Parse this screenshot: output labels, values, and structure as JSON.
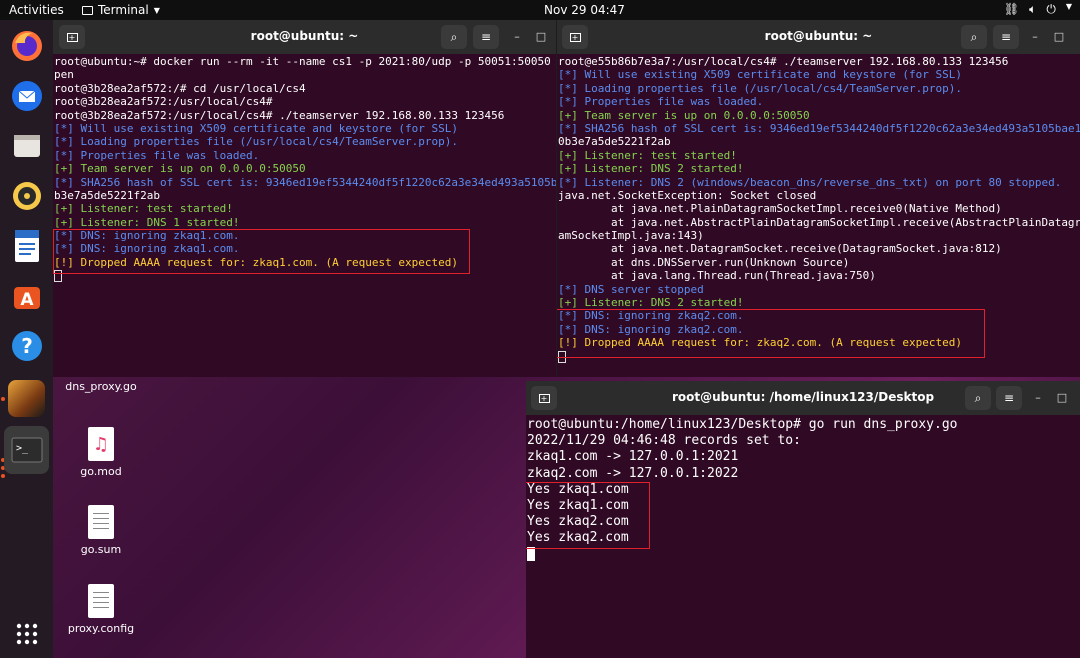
{
  "topbar": {
    "activities": "Activities",
    "app": "Terminal",
    "clock": "Nov 29  04:47"
  },
  "dock": {
    "items": [
      "firefox-icon",
      "thunderbird-icon",
      "files-icon",
      "rhythmbox-icon",
      "writer-icon",
      "software-icon",
      "help-icon",
      "avatar-icon",
      "terminal-icon"
    ],
    "apps_grid": "show-apps-icon"
  },
  "desktop": {
    "icons": [
      {
        "label": "dns_proxy.go"
      },
      {
        "label": "go.mod"
      },
      {
        "label": "go.sum"
      },
      {
        "label": "proxy.config"
      }
    ]
  },
  "term1": {
    "title": "root@ubuntu: ~",
    "lines": [
      {
        "t": "root@ubuntu:~# docker run --rm -it --name cs1 -p 2021:80/udp -p 50051:50050",
        "c": ""
      },
      {
        "t": "pen",
        "c": ""
      },
      {
        "t": "root@3b28ea2af572:/# cd /usr/local/cs4",
        "c": ""
      },
      {
        "t": "root@3b28ea2af572:/usr/local/cs4#",
        "c": ""
      },
      {
        "t": "root@3b28ea2af572:/usr/local/cs4# ./teamserver 192.168.80.133 123456",
        "c": ""
      },
      {
        "p": "[*]",
        "t": " Will use existing X509 certificate and keystore (for SSL)",
        "c": "blue"
      },
      {
        "p": "[*]",
        "t": " Loading properties file (/usr/local/cs4/TeamServer.prop).",
        "c": "blue"
      },
      {
        "p": "[*]",
        "t": " Properties file was loaded.",
        "c": "blue"
      },
      {
        "p": "[+]",
        "t": " Team server is up on 0.0.0.0:50050",
        "c": "green"
      },
      {
        "p": "[*]",
        "t": " SHA256 hash of SSL cert is: 9346ed19ef5344240df5f1220c62a3e34ed493a5105b",
        "c": "blue"
      },
      {
        "t": "b3e7a5de5221f2ab",
        "c": ""
      },
      {
        "p": "[+]",
        "t": " Listener: test started!",
        "c": "green"
      },
      {
        "p": "[+]",
        "t": " Listener: DNS 1 started!",
        "c": "green"
      },
      {
        "p": "[*]",
        "t": " DNS: ignoring zkaq1.com.",
        "c": "blue"
      },
      {
        "p": "[*]",
        "t": " DNS: ignoring zkaq1.com.",
        "c": "blue"
      },
      {
        "p": "[!]",
        "t": " Dropped AAAA request for: zkaq1.com. (A request expected)",
        "c": "yellow"
      }
    ]
  },
  "term2": {
    "title": "root@ubuntu: ~",
    "lines": [
      {
        "t": "root@e55b86b7e3a7:/usr/local/cs4# ./teamserver 192.168.80.133 123456",
        "c": ""
      },
      {
        "p": "[*]",
        "t": " Will use existing X509 certificate and keystore (for SSL)",
        "c": "blue"
      },
      {
        "p": "[*]",
        "t": " Loading properties file (/usr/local/cs4/TeamServer.prop).",
        "c": "blue"
      },
      {
        "p": "[*]",
        "t": " Properties file was loaded.",
        "c": "blue"
      },
      {
        "p": "[+]",
        "t": " Team server is up on 0.0.0.0:50050",
        "c": "green"
      },
      {
        "p": "[*]",
        "t": " SHA256 hash of SSL cert is: 9346ed19ef5344240df5f1220c62a3e34ed493a5105bae1",
        "c": "blue"
      },
      {
        "t": "0b3e7a5de5221f2ab",
        "c": ""
      },
      {
        "p": "[+]",
        "t": " Listener: test started!",
        "c": "green"
      },
      {
        "p": "[+]",
        "t": " Listener: DNS 2 started!",
        "c": "green"
      },
      {
        "p": "[*]",
        "t": " Listener: DNS 2 (windows/beacon_dns/reverse_dns_txt) on port 80 stopped.",
        "c": "blue"
      },
      {
        "t": "java.net.SocketException: Socket closed",
        "c": ""
      },
      {
        "t": "        at java.net.PlainDatagramSocketImpl.receive0(Native Method)",
        "c": ""
      },
      {
        "t": "        at java.net.AbstractPlainDatagramSocketImpl.receive(AbstractPlainDatagr",
        "c": ""
      },
      {
        "t": "amSocketImpl.java:143)",
        "c": ""
      },
      {
        "t": "        at java.net.DatagramSocket.receive(DatagramSocket.java:812)",
        "c": ""
      },
      {
        "t": "        at dns.DNSServer.run(Unknown Source)",
        "c": ""
      },
      {
        "t": "        at java.lang.Thread.run(Thread.java:750)",
        "c": ""
      },
      {
        "p": "[*]",
        "t": " DNS server stopped",
        "c": "blue"
      },
      {
        "p": "[+]",
        "t": " Listener: DNS 2 started!",
        "c": "green"
      },
      {
        "p": "[*]",
        "t": " DNS: ignoring zkaq2.com.",
        "c": "blue"
      },
      {
        "p": "[*]",
        "t": " DNS: ignoring zkaq2.com.",
        "c": "blue"
      },
      {
        "p": "[!]",
        "t": " Dropped AAAA request for: zkaq2.com. (A request expected)",
        "c": "yellow"
      }
    ]
  },
  "term3": {
    "title": "root@ubuntu: /home/linux123/Desktop",
    "lines": [
      {
        "t": "root@ubuntu:/home/linux123/Desktop# go run dns_proxy.go",
        "c": ""
      },
      {
        "t": "2022/11/29 04:46:48 records set to:",
        "c": ""
      },
      {
        "t": "zkaq1.com -> 127.0.0.1:2021",
        "c": ""
      },
      {
        "t": "zkaq2.com -> 127.0.0.1:2022",
        "c": ""
      },
      {
        "t": "Yes zkaq1.com",
        "c": ""
      },
      {
        "t": "Yes zkaq1.com",
        "c": ""
      },
      {
        "t": "Yes zkaq2.com",
        "c": ""
      },
      {
        "t": "Yes zkaq2.com",
        "c": ""
      }
    ]
  }
}
